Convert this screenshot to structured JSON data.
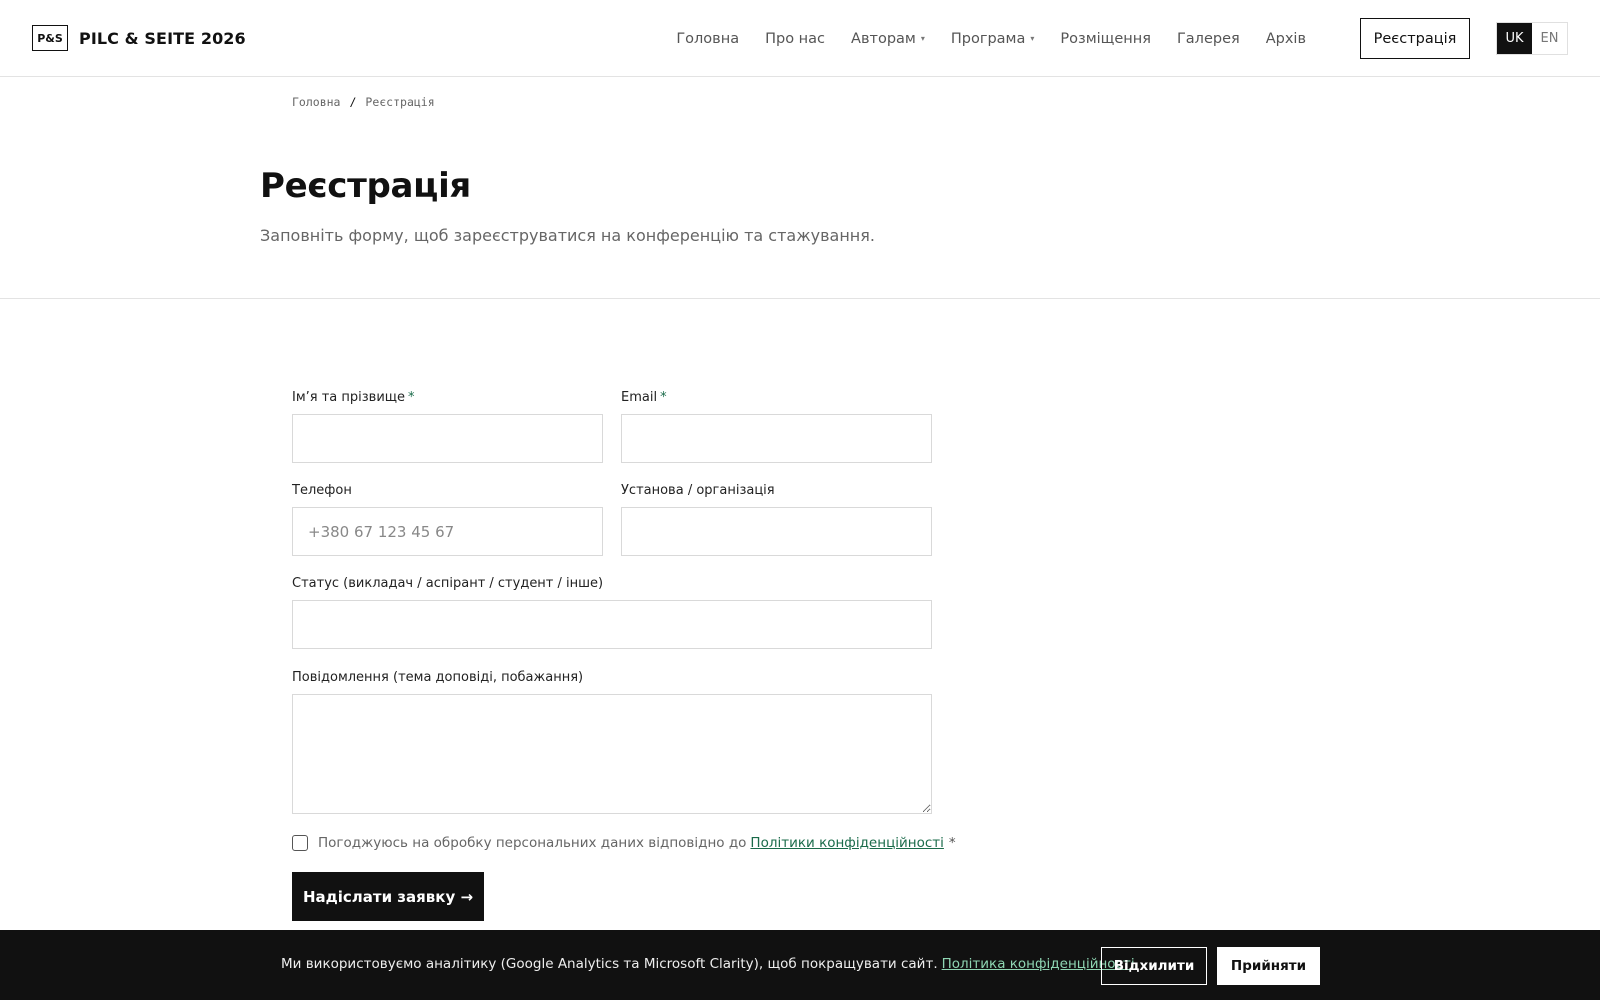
{
  "header": {
    "logo_mark": "P&S",
    "logo_text": "PILC & SEITE 2026",
    "nav": [
      {
        "label": "Головна",
        "dropdown": false
      },
      {
        "label": "Про нас",
        "dropdown": false
      },
      {
        "label": "Авторам",
        "dropdown": true
      },
      {
        "label": "Програма",
        "dropdown": true
      },
      {
        "label": "Розміщення",
        "dropdown": false
      },
      {
        "label": "Галерея",
        "dropdown": false
      },
      {
        "label": "Архів",
        "dropdown": false
      }
    ],
    "register_label": "Реєстрація",
    "languages": [
      {
        "code": "UK",
        "active": true
      },
      {
        "code": "EN",
        "active": false
      }
    ]
  },
  "breadcrumb": {
    "home": "Головна",
    "separator": "/",
    "current": "Реєстрація"
  },
  "hero": {
    "title": "Реєстрація",
    "subtitle": "Заповніть форму, щоб зареєструватися на конференцію та стажування."
  },
  "form": {
    "name": {
      "label": "Ім’я та прізвище",
      "required_mark": "*",
      "value": "",
      "placeholder": ""
    },
    "email": {
      "label": "Email",
      "required_mark": "*",
      "value": "",
      "placeholder": ""
    },
    "phone": {
      "label": "Телефон",
      "value": "",
      "placeholder": "+380 67 123 45 67"
    },
    "organization": {
      "label": "Установа / організація",
      "value": "",
      "placeholder": ""
    },
    "status": {
      "label": "Статус (викладач / аспірант / студент / інше)",
      "value": "",
      "placeholder": ""
    },
    "message": {
      "label": "Повідомлення (тема доповіді, побажання)",
      "value": "",
      "placeholder": ""
    },
    "consent": {
      "text": "Погоджуюсь на обробку персональних даних відповідно до",
      "link": "Політики конфіденційності",
      "required_mark": "*",
      "checked": false
    },
    "submit_label": "Надіслати заявку →"
  },
  "cookie": {
    "text": "Ми використовуємо аналітику (Google Analytics та Microsoft Clarity), щоб покращувати сайт.",
    "link": "Політика конфіденційності",
    "decline": "Відхилити",
    "accept": "Прийняти"
  },
  "colors": {
    "accent": "#1a6b4a",
    "text": "#111111",
    "muted": "#666666",
    "border": "#d9d9d9",
    "cookie_bg": "#111111",
    "cookie_link": "#8fd6b3"
  }
}
